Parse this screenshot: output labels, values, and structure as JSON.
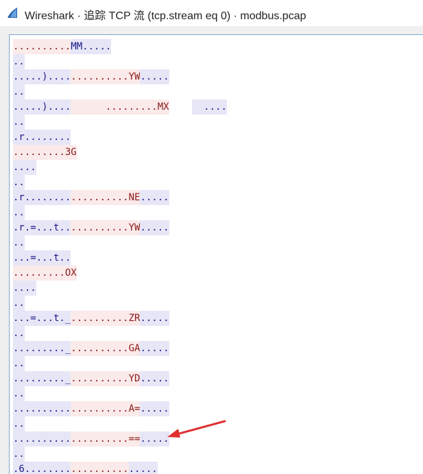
{
  "window": {
    "title": "Wireshark · 追踪 TCP 流 (tcp.stream eq 0) · modbus.pcap",
    "icon": "wireshark-fin-icon"
  },
  "colors": {
    "client_bg": "#e6e6f7",
    "client_fg": "#1a1a8a",
    "server_bg": "#fbeaea",
    "server_fg": "#8a1a1a",
    "arrow": "#e03030"
  },
  "stream_rows": [
    [
      {
        "t": "server",
        "v": ".........."
      },
      {
        "t": "client",
        "v": "MM....."
      }
    ],
    [
      {
        "t": "client",
        "v": ".."
      }
    ],
    [
      {
        "t": "client",
        "v": ".....)...."
      },
      {
        "t": "server",
        "v": "..........YW"
      },
      {
        "t": "client",
        "v": "....."
      }
    ],
    [
      {
        "t": "client",
        "v": ".."
      }
    ],
    [
      {
        "t": "client",
        "v": ".....)...."
      },
      {
        "t": "server",
        "v": "      .........MX"
      },
      {
        "t": "blank",
        "v": "    "
      },
      {
        "t": "client",
        "v": "  ...."
      }
    ],
    [
      {
        "t": "client",
        "v": ".."
      }
    ],
    [
      {
        "t": "client",
        "v": ".r........"
      }
    ],
    [
      {
        "t": "server",
        "v": ".........3G"
      }
    ],
    [
      {
        "t": "client",
        "v": "...."
      }
    ],
    [
      {
        "t": "client",
        "v": ".."
      }
    ],
    [
      {
        "t": "client",
        "v": ".r........"
      },
      {
        "t": "server",
        "v": "..........NE"
      },
      {
        "t": "client",
        "v": "....."
      }
    ],
    [
      {
        "t": "client",
        "v": ".."
      }
    ],
    [
      {
        "t": "client",
        "v": ".r.=...t.."
      },
      {
        "t": "server",
        "v": "..........YW"
      },
      {
        "t": "client",
        "v": "....."
      }
    ],
    [
      {
        "t": "client",
        "v": ".."
      }
    ],
    [
      {
        "t": "client",
        "v": "...=...t.."
      }
    ],
    [
      {
        "t": "server",
        "v": ".........OX"
      }
    ],
    [
      {
        "t": "client",
        "v": "...."
      }
    ],
    [
      {
        "t": "client",
        "v": ".."
      }
    ],
    [
      {
        "t": "client",
        "v": "...=...t._"
      },
      {
        "t": "server",
        "v": "..........ZR"
      },
      {
        "t": "client",
        "v": "....."
      }
    ],
    [
      {
        "t": "client",
        "v": ".."
      }
    ],
    [
      {
        "t": "client",
        "v": "........._"
      },
      {
        "t": "server",
        "v": "..........GA"
      },
      {
        "t": "client",
        "v": "....."
      }
    ],
    [
      {
        "t": "client",
        "v": ".."
      }
    ],
    [
      {
        "t": "client",
        "v": "........._"
      },
      {
        "t": "server",
        "v": "..........YD"
      },
      {
        "t": "client",
        "v": "....."
      }
    ],
    [
      {
        "t": "client",
        "v": ".."
      }
    ],
    [
      {
        "t": "client",
        "v": ".........."
      },
      {
        "t": "server",
        "v": "..........A="
      },
      {
        "t": "client",
        "v": "....."
      }
    ],
    [
      {
        "t": "client",
        "v": ".."
      }
    ],
    [
      {
        "t": "client",
        "v": ".........."
      },
      {
        "t": "server",
        "v": "..........=="
      },
      {
        "t": "client",
        "v": "....."
      }
    ],
    [
      {
        "t": "client",
        "v": ".."
      }
    ],
    [
      {
        "t": "client",
        "v": ".6........"
      },
      {
        "t": "server",
        "v": ".........."
      },
      {
        "t": "client",
        "v": "....."
      }
    ]
  ]
}
